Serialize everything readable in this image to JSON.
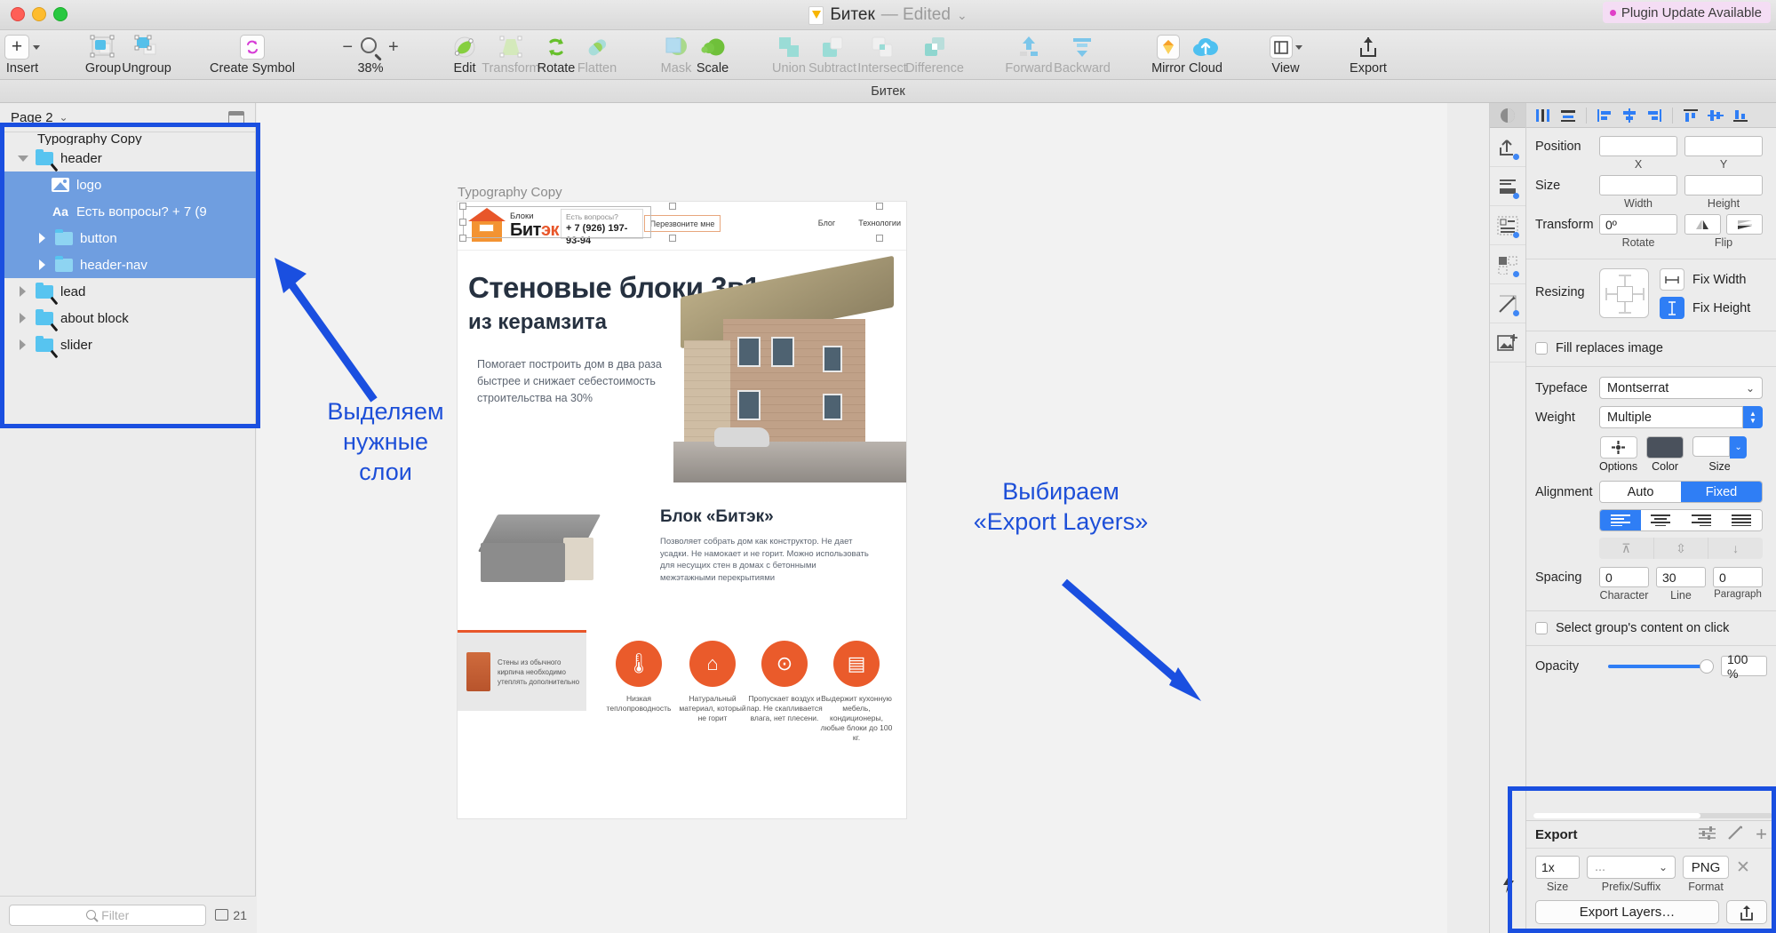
{
  "window": {
    "title": "Битек",
    "edited_suffix": "— Edited",
    "plugin_badge": "Plugin Update Available",
    "tab_label": "Битек"
  },
  "toolbar": {
    "items": [
      {
        "label": "Insert",
        "icon": "plus-icon",
        "dim": false
      },
      {
        "label": "Group",
        "icon": "group-icon",
        "dim": false
      },
      {
        "label": "Ungroup",
        "icon": "ungroup-icon",
        "dim": false
      },
      {
        "label": "Create Symbol",
        "icon": "symbol-icon",
        "dim": false
      },
      {
        "label": "Edit",
        "icon": "edit-icon",
        "dim": false
      },
      {
        "label": "Transform",
        "icon": "transform-icon",
        "dim": true
      },
      {
        "label": "Rotate",
        "icon": "rotate-icon",
        "dim": false
      },
      {
        "label": "Flatten",
        "icon": "flatten-icon",
        "dim": true
      },
      {
        "label": "Mask",
        "icon": "mask-icon",
        "dim": true
      },
      {
        "label": "Scale",
        "icon": "scale-icon",
        "dim": false
      },
      {
        "label": "Union",
        "icon": "union-icon",
        "dim": true
      },
      {
        "label": "Subtract",
        "icon": "subtract-icon",
        "dim": true
      },
      {
        "label": "Intersect",
        "icon": "intersect-icon",
        "dim": true
      },
      {
        "label": "Difference",
        "icon": "difference-icon",
        "dim": true
      },
      {
        "label": "Forward",
        "icon": "forward-icon",
        "dim": true
      },
      {
        "label": "Backward",
        "icon": "backward-icon",
        "dim": true
      },
      {
        "label": "Mirror",
        "icon": "mirror-icon",
        "dim": false
      },
      {
        "label": "Cloud",
        "icon": "cloud-icon",
        "dim": false
      },
      {
        "label": "View",
        "icon": "view-icon",
        "dim": false
      },
      {
        "label": "Export",
        "icon": "export-icon",
        "dim": false
      }
    ],
    "zoom_level": "38%",
    "zoom_minus": "−",
    "zoom_plus": "+"
  },
  "left_panel": {
    "page_name": "Page 2",
    "layers": [
      {
        "name": "Typography Copy",
        "indent": 0,
        "type": "clipped",
        "disclosure": "none",
        "selected": false
      },
      {
        "name": "header",
        "indent": 0,
        "type": "folder",
        "disclosure": "down",
        "selected": false,
        "edited": true
      },
      {
        "name": "logo",
        "indent": 2,
        "type": "image",
        "disclosure": "none",
        "selected": true
      },
      {
        "name": "Есть вопросы? + 7 (9",
        "indent": 2,
        "type": "text",
        "disclosure": "none",
        "selected": true
      },
      {
        "name": "button",
        "indent": 1,
        "type": "folder",
        "disclosure": "right",
        "selected": true
      },
      {
        "name": "header-nav",
        "indent": 1,
        "type": "folder",
        "disclosure": "right",
        "selected": true
      },
      {
        "name": "lead",
        "indent": 0,
        "type": "folder",
        "disclosure": "right",
        "selected": false,
        "edited": true
      },
      {
        "name": "about block",
        "indent": 0,
        "type": "folder",
        "disclosure": "right",
        "selected": false,
        "edited": true
      },
      {
        "name": "slider",
        "indent": 0,
        "type": "folder",
        "disclosure": "right",
        "selected": false,
        "edited": true
      }
    ],
    "filter_placeholder": "Filter",
    "layer_count": "21"
  },
  "canvas": {
    "artboard_label": "Typography Copy",
    "artboard": {
      "logo_small": "Блоки",
      "logo_main_a": "Бит",
      "logo_main_b": "эк",
      "question_label": "Есть вопросы?",
      "phone": "+ 7 (926) 197-93-94",
      "callback_button": "Перезвоните мне",
      "nav": [
        "Блог",
        "Технологии"
      ],
      "headline": "Стеновые блоки 3в1",
      "subheadline": "из керамзита",
      "lead_text": "Помогает построить дом в два раза быстрее и снижает себестоимость строительства на 30%",
      "block_title": "Блок «Битэк»",
      "block_body": "Позволяет собрать дом как конструктор. Не дает усадки. Не намокает и не горит. Можно использовать для несущих стен в домах с бетонными межэтажными перекрытиями",
      "feature_card_text": "Стены из обычного кирпича необходимо утеплять дополнительно",
      "features": [
        {
          "icon": "thermometer-icon",
          "text": "Низкая теплопроводность"
        },
        {
          "icon": "house-icon",
          "text": "Натуральный материал, который не горит"
        },
        {
          "icon": "humidity-icon",
          "text": "Пропускает воздух и пар. Не скапливается влага, нет плесени."
        },
        {
          "icon": "weight-icon",
          "text": "Выдержит кухонную мебель, кондиционеры, любые блоки до 100 кг."
        }
      ]
    },
    "annotations": [
      {
        "id": "left-note",
        "text": "Выделяем\nнужные\nслои",
        "color": "#1d4fd8"
      },
      {
        "id": "right-note",
        "text": "Выбираем\n«Export Layers»",
        "color": "#1d4fd8"
      }
    ]
  },
  "inspector": {
    "position_label": "Position",
    "x_label": "X",
    "y_label": "Y",
    "x_value": "",
    "y_value": "",
    "size_label": "Size",
    "width_label": "Width",
    "height_label": "Height",
    "width_value": "",
    "height_value": "",
    "transform_label": "Transform",
    "rotate_value": "0º",
    "rotate_label": "Rotate",
    "flip_label": "Flip",
    "resizing_label": "Resizing",
    "fix_width_label": "Fix Width",
    "fix_height_label": "Fix Height",
    "fill_replaces_image": "Fill replaces image",
    "typeface_label": "Typeface",
    "typeface_value": "Montserrat",
    "weight_label": "Weight",
    "weight_value": "Multiple",
    "options_label": "Options",
    "color_label": "Color",
    "size_small_label": "Size",
    "color_swatch": "#4a515c",
    "alignment_label": "Alignment",
    "alignment_auto": "Auto",
    "alignment_fixed": "Fixed",
    "spacing_label": "Spacing",
    "spacing_character": "0",
    "spacing_line": "30",
    "spacing_paragraph": "0",
    "character_label": "Character",
    "line_label": "Line",
    "paragraph_label": "Paragraph",
    "select_group_content": "Select group's content on click",
    "opacity_label": "Opacity",
    "opacity_value": "100 %"
  },
  "export": {
    "title": "Export",
    "size_value": "1x",
    "size_label": "Size",
    "prefix_value": "...",
    "prefix_label": "Prefix/Suffix",
    "format_value": "PNG",
    "format_label": "Format",
    "export_button": "Export Layers…"
  },
  "colors": {
    "accent_blue": "#2f7ef5",
    "selection_blue": "#6f9ee0",
    "annotation_blue": "#1a4fe0",
    "brand_orange": "#e8562a"
  }
}
